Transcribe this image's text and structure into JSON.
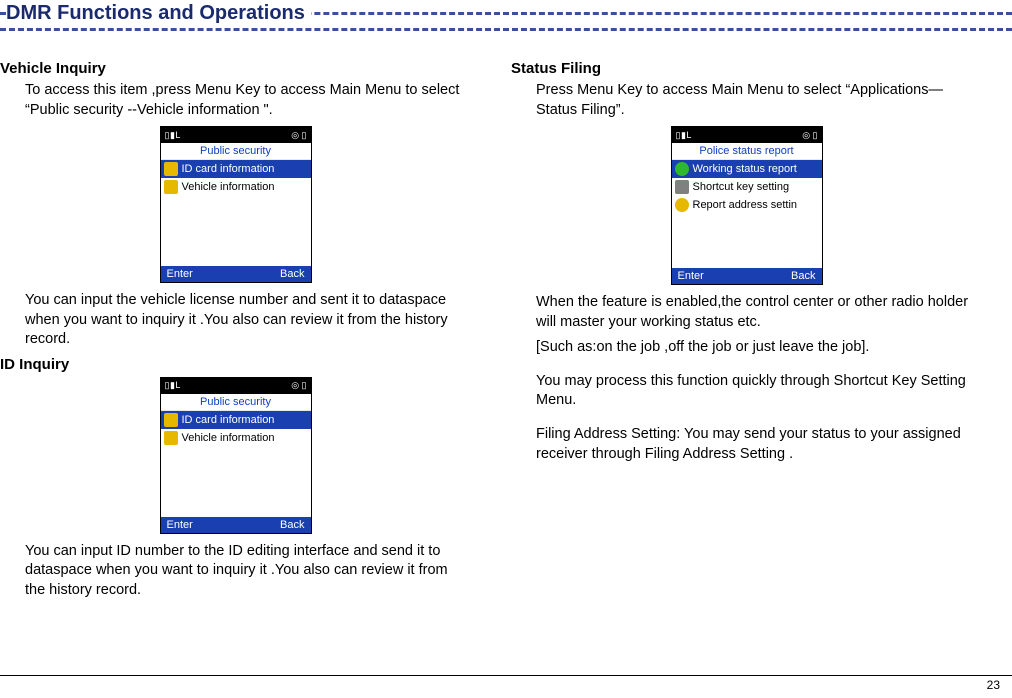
{
  "header": {
    "title": "DMR Functions and Operations"
  },
  "left": {
    "vehicle": {
      "title": "Vehicle Inquiry",
      "p1": "To access this item ,press Menu Key to access Main Menu to select “Public security --Vehicle information \".",
      "p2": "You can input the vehicle license number and sent it to dataspace when you want to inquiry it .You also can review it from the history record."
    },
    "id": {
      "title": "ID Inquiry",
      "p1": "You can input ID number to the ID editing  interface and send it to dataspace when you want to inquiry it .You also can review it from the history record."
    },
    "screen1": {
      "title": "Public security",
      "rows": [
        {
          "icon": "card",
          "label": "ID card information",
          "sel": true
        },
        {
          "icon": "car",
          "label": "Vehicle information",
          "sel": false
        }
      ],
      "foot_left": "Enter",
      "foot_right": "Back",
      "status_left": "▯ ▮ L",
      "status_right": "◎ ▯"
    }
  },
  "right": {
    "status": {
      "title": "Status  Filing",
      "p1": "Press  Menu Key to access Main Menu to select “Applications—Status Filing”.",
      "p2": "When the feature is enabled,the control center or other radio holder will master your working status etc.",
      "p3": "[Such as:on the job ,off the job or just leave the job].",
      "p4": "You may process this function quickly through Shortcut Key Setting Menu.",
      "p5": "Filing Address Setting: You may send your status to your assigned receiver through Filing  Address Setting ."
    },
    "screen2": {
      "title": "Police status report",
      "rows": [
        {
          "icon": "green",
          "label": "Working status report",
          "sel": true
        },
        {
          "icon": "grey",
          "label": "Shortcut key setting",
          "sel": false
        },
        {
          "icon": "gear",
          "label": "Report address settin",
          "sel": false
        }
      ],
      "foot_left": "Enter",
      "foot_right": "Back",
      "status_left": "▯ ▮ L",
      "status_right": "◎ ▯"
    }
  },
  "page": "23"
}
